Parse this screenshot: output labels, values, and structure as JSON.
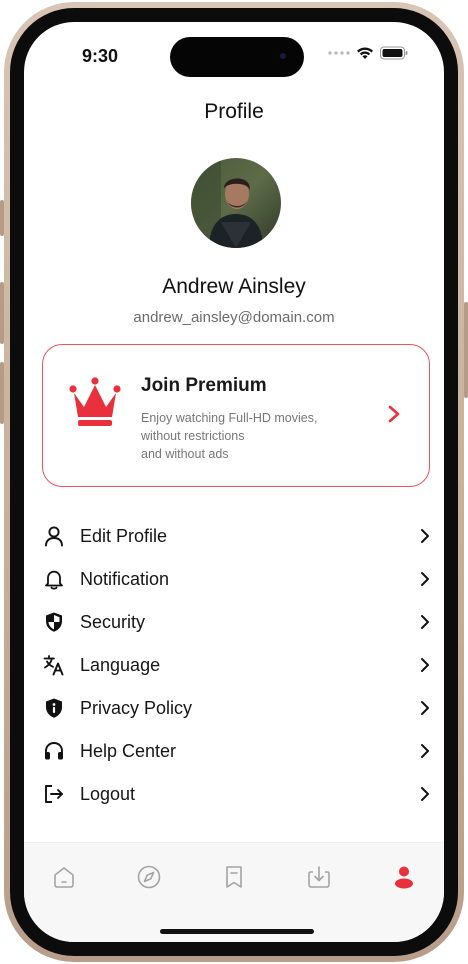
{
  "status_bar": {
    "time": "9:30",
    "signal_icon": "signal-dots-icon",
    "wifi_icon": "wifi-icon",
    "battery_icon": "battery-icon"
  },
  "header": {
    "title": "Profile"
  },
  "user": {
    "name": "Andrew Ainsley",
    "email": "andrew_ainsley@domain.com",
    "avatar_icon": "avatar-photo"
  },
  "premium": {
    "title": "Join Premium",
    "description_lines": [
      "Enjoy watching Full-HD movies,",
      "without restrictions",
      "and without ads"
    ],
    "icon": "crown-icon",
    "accent_color": "#e8313c"
  },
  "menu": {
    "items": [
      {
        "label": "Edit Profile",
        "icon": "user-icon"
      },
      {
        "label": "Notification",
        "icon": "bell-icon"
      },
      {
        "label": "Security",
        "icon": "shield-icon"
      },
      {
        "label": "Language",
        "icon": "translate-icon"
      },
      {
        "label": "Privacy Policy",
        "icon": "privacy-shield-icon"
      },
      {
        "label": "Help Center",
        "icon": "headphones-icon"
      },
      {
        "label": "Logout",
        "icon": "logout-icon"
      }
    ]
  },
  "tabbar": {
    "tabs": [
      {
        "icon": "home-icon",
        "active": false
      },
      {
        "icon": "compass-icon",
        "active": false
      },
      {
        "icon": "bookmark-icon",
        "active": false
      },
      {
        "icon": "download-icon",
        "active": false
      },
      {
        "icon": "profile-icon",
        "active": true
      }
    ],
    "active_color": "#e8313c",
    "inactive_color": "#a3a3a3"
  }
}
